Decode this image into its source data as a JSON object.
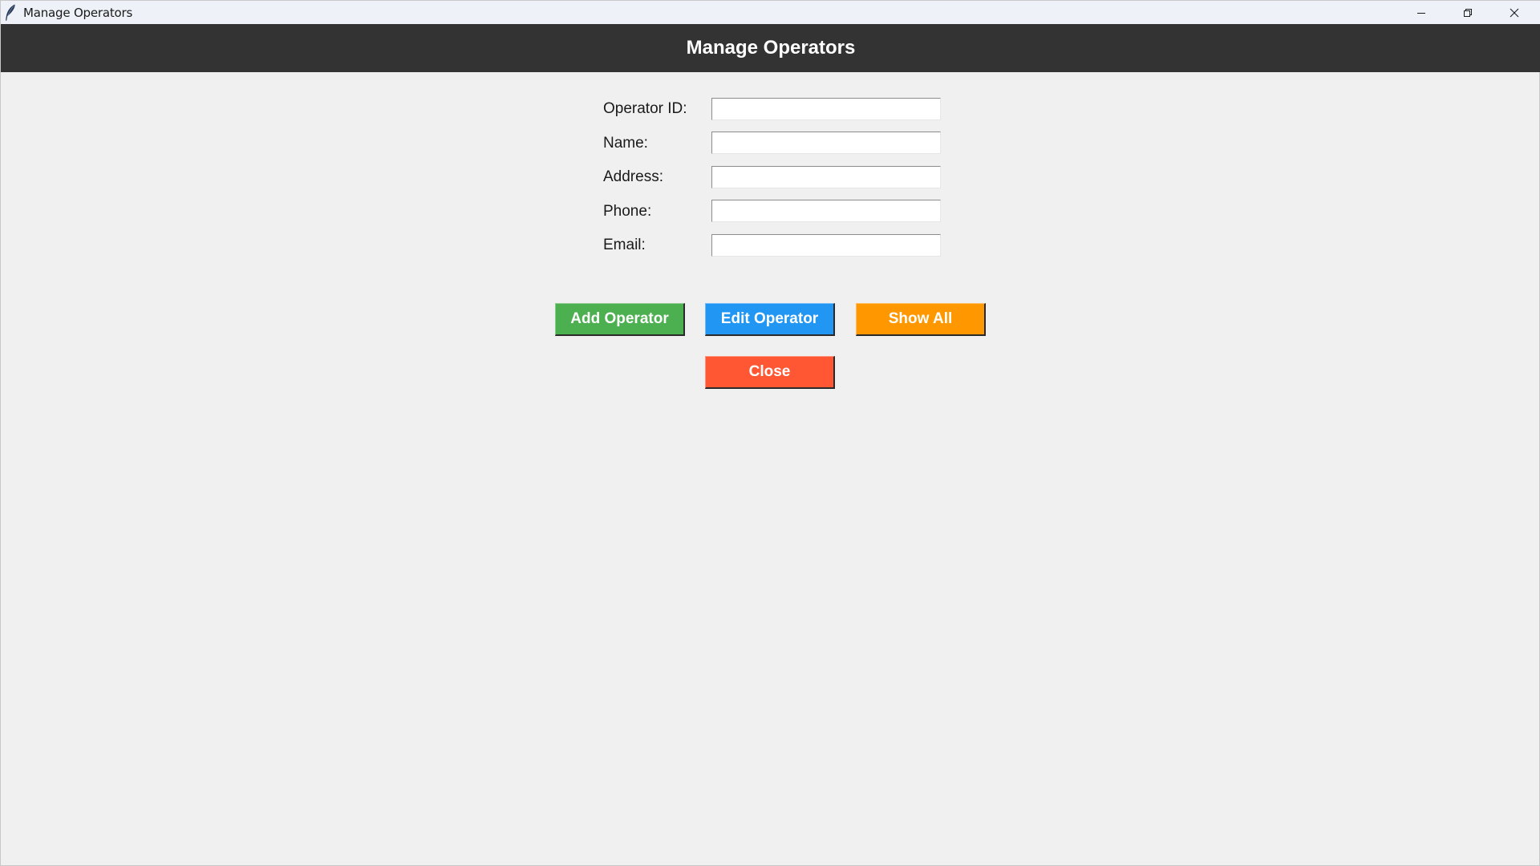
{
  "window": {
    "title": "Manage Operators",
    "controls": {
      "minimize_icon": "minimize-icon",
      "maximize_icon": "restore-icon",
      "close_icon": "close-icon"
    }
  },
  "header": {
    "title": "Manage Operators",
    "background": "#333333"
  },
  "form": {
    "fields": [
      {
        "label": "Operator ID:",
        "value": ""
      },
      {
        "label": "Name:",
        "value": ""
      },
      {
        "label": "Address:",
        "value": ""
      },
      {
        "label": "Phone:",
        "value": ""
      },
      {
        "label": "Email:",
        "value": ""
      }
    ]
  },
  "actions": {
    "add_label": "Add Operator",
    "add_color": "#4caf50",
    "edit_label": "Edit Operator",
    "edit_color": "#2196f3",
    "show_label": "Show All",
    "show_color": "#ff9800",
    "close_label": "Close",
    "close_color": "#ff5733"
  }
}
